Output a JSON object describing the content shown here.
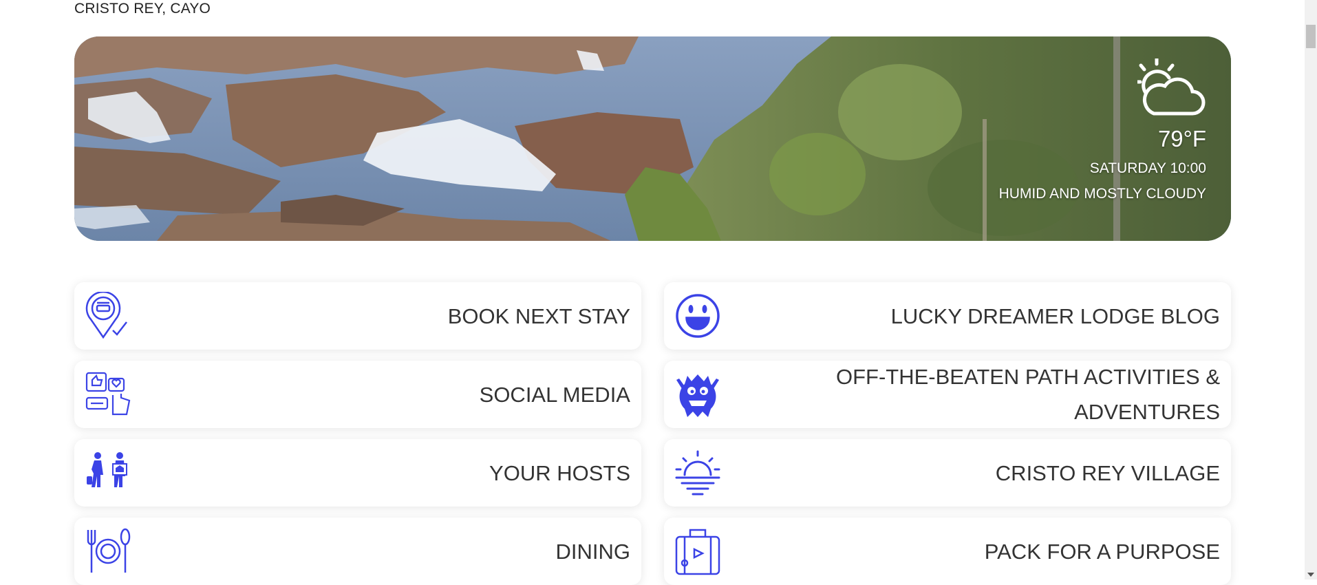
{
  "header": {
    "location": "CRISTO REY, CAYO"
  },
  "weather": {
    "icon": "partly-cloudy-sun-icon",
    "temperature": "79°F",
    "datetime": "SATURDAY 10:00",
    "condition": "HUMID AND MOSTLY CLOUDY"
  },
  "colors": {
    "accent": "#3b43e6",
    "card_text": "#333333"
  },
  "cards": [
    {
      "label": "BOOK NEXT STAY",
      "icon": "booking-pin-icon"
    },
    {
      "label": "LUCKY DREAMER LODGE BLOG",
      "icon": "smiley-face-icon"
    },
    {
      "label": "SOCIAL MEDIA",
      "icon": "social-media-icon"
    },
    {
      "label": "OFF-THE-BEATEN PATH ACTIVITIES & ADVENTURES",
      "icon": "monster-icon"
    },
    {
      "label": "YOUR HOSTS",
      "icon": "hosts-icon"
    },
    {
      "label": "CRISTO REY VILLAGE",
      "icon": "sunrise-icon"
    },
    {
      "label": "DINING",
      "icon": "dining-icon"
    },
    {
      "label": "PACK FOR A PURPOSE",
      "icon": "suitcase-icon"
    }
  ]
}
